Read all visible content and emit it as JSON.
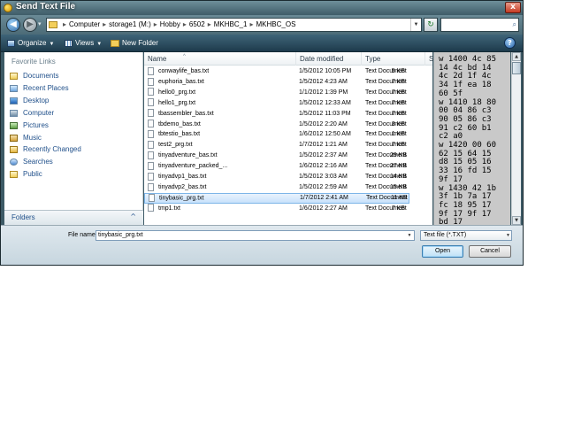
{
  "window": {
    "title": "Send Text File",
    "close_label": "x"
  },
  "address_bar": {
    "breadcrumbs": [
      "Computer",
      "storage1 (M:)",
      "Hobby",
      "6502",
      "MKHBC_1",
      "MKHBC_OS"
    ],
    "separator": "▸",
    "back_label": "◀",
    "forward_label": "▶"
  },
  "toolbar": {
    "organize": "Organize",
    "views": "Views",
    "new_folder": "New Folder",
    "help": "?"
  },
  "nav": {
    "header": "Favorite Links",
    "items": [
      {
        "label": "Documents",
        "icon": "documents-icon"
      },
      {
        "label": "Recent Places",
        "icon": "recent-places-icon"
      },
      {
        "label": "Desktop",
        "icon": "desktop-icon"
      },
      {
        "label": "Computer",
        "icon": "computer-icon"
      },
      {
        "label": "Pictures",
        "icon": "pictures-icon"
      },
      {
        "label": "Music",
        "icon": "music-icon"
      },
      {
        "label": "Recently Changed",
        "icon": "recently-changed-icon"
      },
      {
        "label": "Searches",
        "icon": "searches-icon"
      },
      {
        "label": "Public",
        "icon": "public-icon"
      }
    ],
    "folders_label": "Folders",
    "folders_chevron": "^"
  },
  "file_list": {
    "columns": {
      "name": "Name",
      "date": "Date modified",
      "type": "Type",
      "size": "Size"
    },
    "sort_arrow": "^",
    "rows": [
      {
        "name": "conwaylife_bas.txt",
        "date": "1/5/2012 10:05 PM",
        "type": "Text Document",
        "size": "5 KB"
      },
      {
        "name": "euphoria_bas.txt",
        "date": "1/5/2012 4:23 AM",
        "type": "Text Document",
        "size": "7 KB"
      },
      {
        "name": "hello0_prg.txt",
        "date": "1/1/2012 1:39 PM",
        "type": "Text Document",
        "size": "7 KB"
      },
      {
        "name": "hello1_prg.txt",
        "date": "1/5/2012 12:33 AM",
        "type": "Text Document",
        "size": "7 KB"
      },
      {
        "name": "tbassembler_bas.txt",
        "date": "1/5/2012 11:03 PM",
        "type": "Text Document",
        "size": "7 KB"
      },
      {
        "name": "tbdemo_bas.txt",
        "date": "1/5/2012 2:20 AM",
        "type": "Text Document",
        "size": "3 KB"
      },
      {
        "name": "tbtestio_bas.txt",
        "date": "1/6/2012 12:50 AM",
        "type": "Text Document",
        "size": "1 KB"
      },
      {
        "name": "test2_prg.txt",
        "date": "1/7/2012 1:21 AM",
        "type": "Text Document",
        "size": "7 KB"
      },
      {
        "name": "tinyadventure_bas.txt",
        "date": "1/5/2012 2:37 AM",
        "type": "Text Document",
        "size": "29 KB"
      },
      {
        "name": "tinyadventure_packed_...",
        "date": "1/6/2012 2:16 AM",
        "type": "Text Document",
        "size": "27 KB"
      },
      {
        "name": "tinyadvp1_bas.txt",
        "date": "1/5/2012 3:03 AM",
        "type": "Text Document",
        "size": "14 KB"
      },
      {
        "name": "tinyadvp2_bas.txt",
        "date": "1/5/2012 2:59 AM",
        "type": "Text Document",
        "size": "15 KB"
      },
      {
        "name": "tinybasic_prg.txt",
        "date": "1/7/2012 2:41 AM",
        "type": "Text Document",
        "size": "11 KB",
        "selected": true
      },
      {
        "name": "tmp1.txt",
        "date": "1/6/2012 2:27 AM",
        "type": "Text Document",
        "size": "7 KB"
      }
    ]
  },
  "preview": {
    "lines": [
      "w 1400 4c 85",
      "14 4c bd 14",
      "4c 2d 1f 4c",
      "34 1f ea 18",
      "60 5f",
      "w 1410 18 80",
      "00 04 86 c3",
      "90 05 86 c3",
      "91 c2 60 b1",
      "c2 a0",
      "w 1420 00 60",
      "62 15 64 15",
      "d8 15 05 16",
      "33 16 fd 15",
      "9f 17",
      "w 1430 42 1b",
      "3f 1b 7a 17",
      "fc 18 95 17",
      "9f 17 9f 17",
      "bd 17"
    ]
  },
  "bottom": {
    "file_name_label": "File name:",
    "file_name_value": "tinybasic_prg.txt",
    "filter_value": "Text file (*.TXT)",
    "open_label": "Open",
    "cancel_label": "Cancel"
  },
  "colors": {
    "accent": "#3c7fb1",
    "titlebar": "#4e6d79",
    "selection": "#c8e1fb"
  }
}
